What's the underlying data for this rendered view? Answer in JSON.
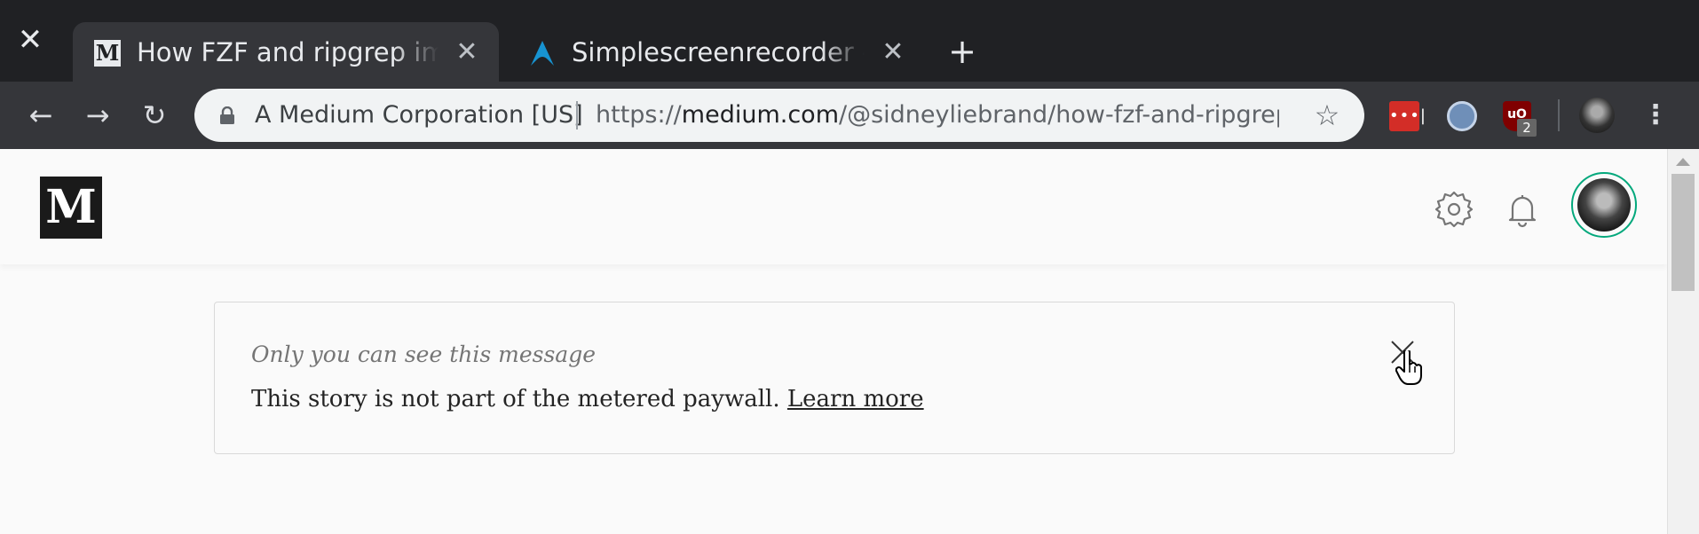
{
  "browser": {
    "window_close_icon": "close-icon",
    "tabs": [
      {
        "title": "How FZF and ripgrep improved my workflow",
        "favicon": "medium-logo",
        "active": true
      },
      {
        "title": "Simplescreenrecorder - en",
        "favicon": "arch-linux-logo",
        "active": false
      }
    ],
    "new_tab_icon": "plus-icon",
    "omnibox": {
      "organization": "A Medium Corporation [US]",
      "url_scheme": "https://",
      "url_host": "medium.com",
      "url_path": "/@sidneyliebrand/how-fzf-and-ripgrep-..."
    },
    "extensions": [
      {
        "name": "lastpass",
        "label": "•••|"
      },
      {
        "name": "round-extension"
      },
      {
        "name": "ublock",
        "label": "uO",
        "badge": "2"
      }
    ]
  },
  "medium": {
    "logo_text": "M",
    "notice": {
      "title": "Only you can see this message",
      "body": "This story is not part of the metered paywall.",
      "link": "Learn more"
    }
  }
}
